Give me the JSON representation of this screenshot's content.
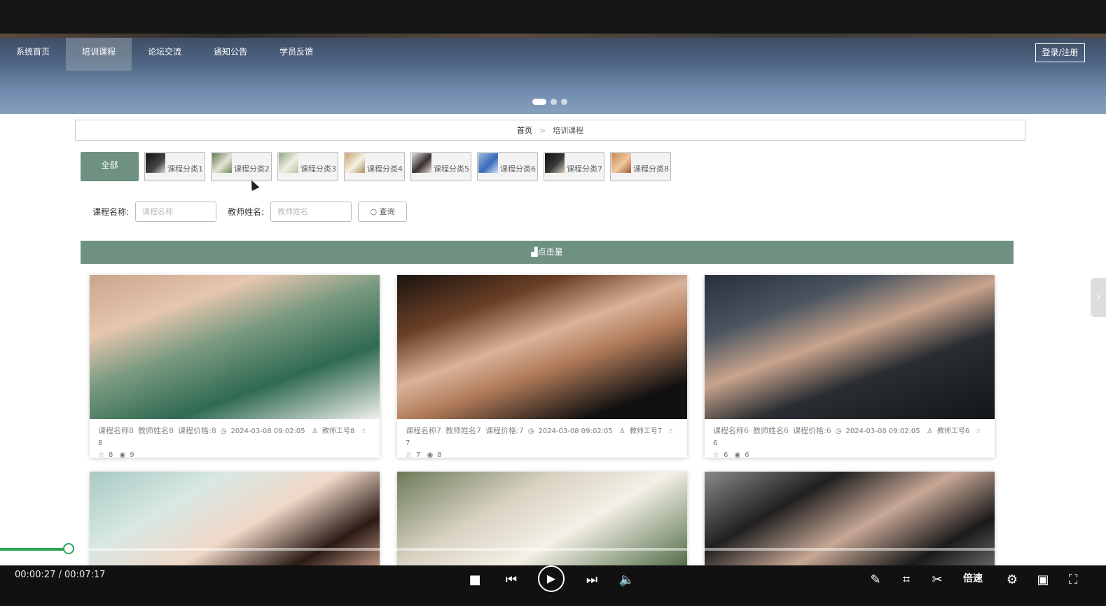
{
  "nav": {
    "items": [
      "系统首页",
      "培训课程",
      "论坛交流",
      "通知公告",
      "学员反馈"
    ],
    "active_index": 1,
    "login_label": "登录/注册"
  },
  "breadcrumb": {
    "home": "首页",
    "separator": ">",
    "current": "培训课程"
  },
  "categories": {
    "all_label": "全部",
    "items": [
      "课程分类1",
      "课程分类2",
      "课程分类3",
      "课程分类4",
      "课程分类5",
      "课程分类6",
      "课程分类7",
      "课程分类8"
    ]
  },
  "search": {
    "course_label": "课程名称:",
    "course_placeholder": "课程名称",
    "teacher_label": "教师姓名:",
    "teacher_placeholder": "教师姓名",
    "button_label": "查询"
  },
  "sort_bar": {
    "label": "点击量"
  },
  "cards": [
    {
      "name": "课程名称8",
      "teacher": "教师姓名8",
      "price": "课程价格:8",
      "date": "2024-03-08 09:02:05",
      "teacher_id": "教师工号8",
      "likes": "8",
      "favorites": "8",
      "views": "9"
    },
    {
      "name": "课程名称7",
      "teacher": "教师姓名7",
      "price": "课程价格:7",
      "date": "2024-03-08 09:02:05",
      "teacher_id": "教师工号7",
      "likes": "7",
      "favorites": "7",
      "views": "8"
    },
    {
      "name": "课程名称6",
      "teacher": "教师姓名6",
      "price": "课程价格:6",
      "date": "2024-03-08 09:02:05",
      "teacher_id": "教师工号6",
      "likes": "6",
      "favorites": "6",
      "views": "6"
    }
  ],
  "player": {
    "time": "00:00:27 / 00:07:17",
    "speed_label": "倍速",
    "progress": 0.062
  },
  "colors": {
    "accent": "#6e9182",
    "progress": "#2aa65a"
  }
}
